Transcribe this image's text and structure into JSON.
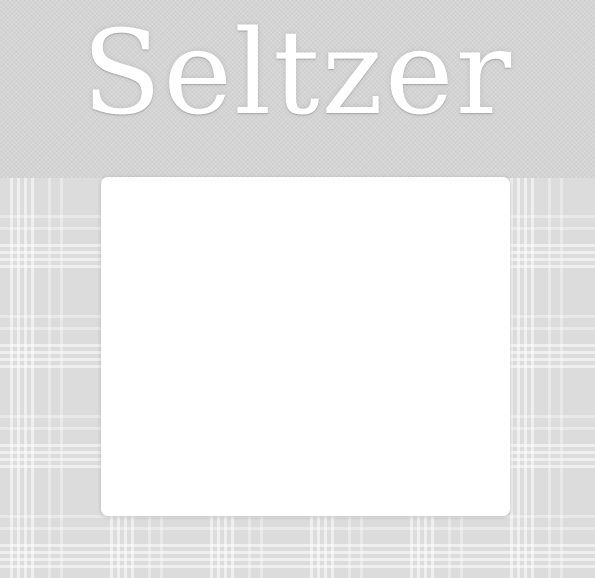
{
  "header": {
    "site_title": "Seltzer"
  },
  "colors": {
    "header_background": "#d4d4d4",
    "page_background": "#dcdcdc",
    "title_text": "#ffffff",
    "panel_background": "#ffffff"
  },
  "main": {
    "content_panel": ""
  }
}
